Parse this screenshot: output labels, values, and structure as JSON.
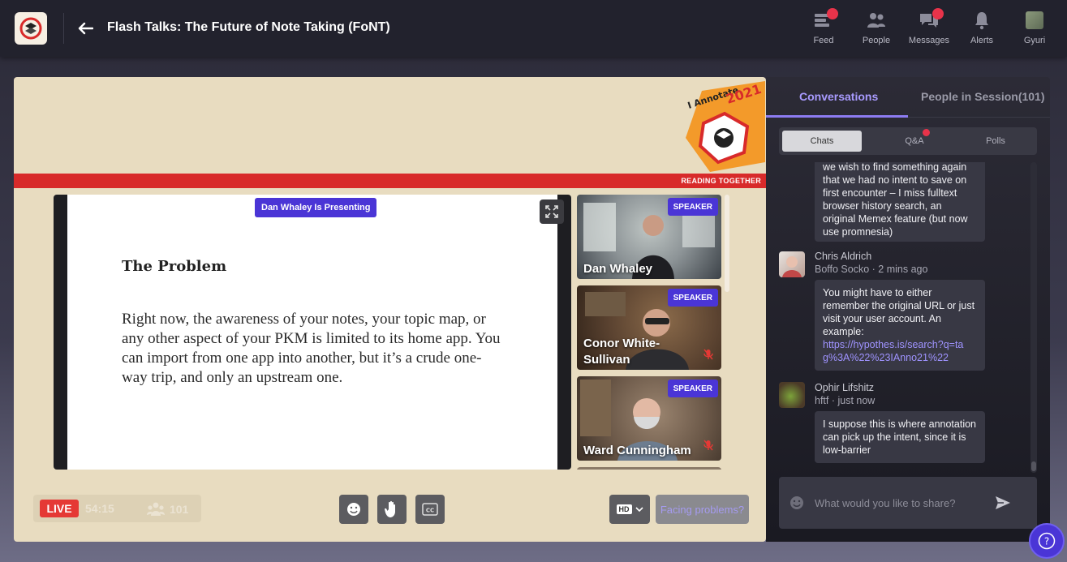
{
  "header": {
    "title": "Flash Talks: The Future of Note Taking (FoNT)",
    "nav": [
      {
        "label": "Feed",
        "icon": "feed-icon",
        "badge": true
      },
      {
        "label": "People",
        "icon": "people-icon",
        "badge": false
      },
      {
        "label": "Messages",
        "icon": "messages-icon",
        "badge": true
      },
      {
        "label": "Alerts",
        "icon": "bell-icon",
        "badge": false
      },
      {
        "label": "Gyuri",
        "icon": "user-avatar",
        "badge": false
      }
    ]
  },
  "stage": {
    "event_badge": {
      "top_text": "I Annotate",
      "year": "2021",
      "tagline": "READING TOGETHER"
    },
    "presenting_label": "Dan Whaley Is Presenting",
    "slide": {
      "heading": "The Problem",
      "body": "Right now, the awareness of your notes, your topic map, or any other aspect of your PKM is limited to its home app.  You can import from one app into another, but it’s a crude one-way trip, and only an upstream one."
    },
    "speakers": [
      {
        "name": "Dan Whaley",
        "tag": "SPEAKER",
        "muted": false
      },
      {
        "name": "Conor White-Sullivan",
        "tag": "SPEAKER",
        "muted": true
      },
      {
        "name": "Ward Cunningham",
        "tag": "SPEAKER",
        "muted": true
      }
    ],
    "controls": {
      "live_label": "LIVE",
      "timer": "54:15",
      "viewers": "101",
      "quality": "HD",
      "facing_problems": "Facing problems?"
    }
  },
  "side": {
    "tabs": {
      "conversations": "Conversations",
      "people": "People in Session(101)"
    },
    "subtabs": {
      "chats": "Chats",
      "qa": "Q&A",
      "polls": "Polls"
    },
    "messages": [
      {
        "text": "we wish to find something again that we had no intent to save on first encounter – I miss fulltext browser history search, an original Memex feature (but now use promnesia)"
      },
      {
        "name": "Chris Aldrich",
        "meta": "Boffo Socko · 2 mins ago",
        "text": "You might have to either remember the original URL or just visit your user account. An example:",
        "link": "https://hypothes.is/search?q=tag%3A%22%23IAnno21%22"
      },
      {
        "name": "Ophir Lifshitz",
        "meta": "hftf · just now",
        "text": "I suppose this is where annotation can pick up the intent, since it is low-barrier"
      }
    ],
    "input": {
      "placeholder": "What would you like to share?"
    }
  },
  "colors": {
    "accent": "#4a35d6",
    "live": "#e53935",
    "band": "#d82a2a",
    "stage_bg": "#e8dcc0",
    "topbar": "#22222d"
  }
}
